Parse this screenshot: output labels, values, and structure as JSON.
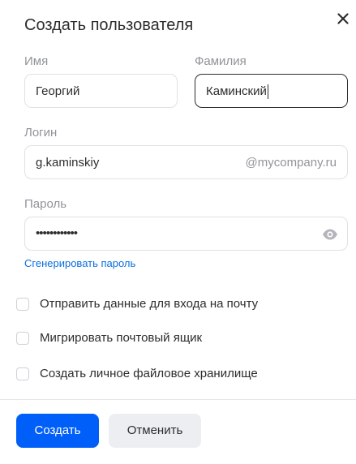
{
  "dialog": {
    "title": "Создать пользователя",
    "close_icon": "close-icon"
  },
  "form": {
    "first_name": {
      "label": "Имя",
      "value": "Георгий"
    },
    "last_name": {
      "label": "Фамилия",
      "value": "Каминский"
    },
    "login": {
      "label": "Логин",
      "value": "g.kaminskiy",
      "domain_suffix": "@mycompany.ru"
    },
    "password": {
      "label": "Пароль",
      "masked_value": "••••••••••••",
      "visibility_icon": "eye-icon"
    },
    "generate_password_link": "Сгенерировать пароль"
  },
  "options": [
    {
      "label": "Отправить данные для входа на почту",
      "checked": false
    },
    {
      "label": "Мигрировать почтовый ящик",
      "checked": false
    },
    {
      "label": "Создать личное файловое хранилище",
      "checked": false
    }
  ],
  "footer": {
    "create_label": "Создать",
    "cancel_label": "Отменить"
  },
  "colors": {
    "primary": "#005ff9",
    "link": "#0a6fe0",
    "secondary_button": "#eceef1",
    "muted_text": "#919399"
  }
}
